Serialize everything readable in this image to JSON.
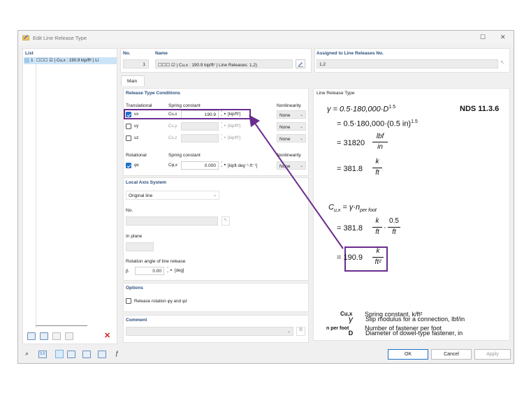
{
  "window": {
    "title": "Edit Line Release Type",
    "minimize_glyph": "☐",
    "close_glyph": "✕"
  },
  "list": {
    "header": "List",
    "item_number": "1",
    "item_text": "☐☐☐ ☑ | Cu,x : 190.9 kip/ft² | Li"
  },
  "header": {
    "no_label": "No.",
    "no_value": "1",
    "name_label": "Name",
    "name_value": "☐☐☐ ☑ | Cu,x : 190.9 kip/ft² | Line Releases: 1,2)",
    "assigned_label": "Assigned to Line Releases No.",
    "assigned_value": "1,2"
  },
  "tabs": [
    {
      "label": "Main"
    }
  ],
  "conditions": {
    "section_title": "Release Type Conditions",
    "translational_label": "Translational",
    "spring_label": "Spring constant",
    "nonlinearity_label": "Nonlinearity",
    "rows": [
      {
        "dof": "ux",
        "const": "Cu,x",
        "value": "190.9",
        "unit": "[kip/ft²]",
        "nonlin": "None"
      },
      {
        "dof": "uy",
        "const": "Cu,y",
        "value": "",
        "unit": "[kip/ft²]",
        "nonlin": "None"
      },
      {
        "dof": "uz",
        "const": "Cu,z",
        "value": "",
        "unit": "[kip/ft²]",
        "nonlin": "None"
      }
    ],
    "rotational_label": "Rotational",
    "rot_spring_label": "Spring constant",
    "rot_nonlinearity_label": "Nonlinearity",
    "rot_row": {
      "dof": "φx",
      "const": "Cφ,x",
      "value": "0.000",
      "unit": "[kipft·deg⁻¹·ft⁻¹]",
      "nonlin": "None"
    }
  },
  "local_axis": {
    "section_title": "Local Axis System",
    "dropdown_value": "Original line",
    "no_label": "No.",
    "in_plane_label": "In plane",
    "rotation_label": "Rotation angle of line release",
    "beta_symbol": "β",
    "beta_value": "0.00",
    "beta_unit": "[deg]"
  },
  "options": {
    "section_title": "Options",
    "release_rotation_label": "Release rotation φy and φz"
  },
  "comment": {
    "section_title": "Comment"
  },
  "diagram": {
    "section_title": "Line Release Type",
    "reference": "NDS 11.3.6",
    "eq1": "γ = 0.5·180,000·D",
    "eq1_exp": "1.5",
    "eq2": "= 0.5·180,000·(0.5 in)",
    "eq2_exp": "1.5",
    "eq3": "= 31820",
    "eq3_num": "lbf",
    "eq3_den": "in",
    "eq4": "= 381.8",
    "eq4_num": "k",
    "eq4_den": "ft",
    "eq5_lhs": "C",
    "eq5_sub": "u,x",
    "eq5_rhs": "= γ·n",
    "eq5_rhs_sub": "per foot",
    "eq6": "= 381.8",
    "eq6_num1": "k",
    "eq6_den1": "ft",
    "eq6_num2": "0.5",
    "eq6_den2": "ft",
    "eq7": "= 190.9",
    "eq7_num": "k",
    "eq7_den": "ft²",
    "legend": [
      {
        "symbol": "γ",
        "text": "Slip modulus for a connection, lbf/in"
      },
      {
        "symbol": "D",
        "text": "Diameter of dowel-type fastener, in"
      },
      {
        "symbol": "Cu,x",
        "text": "Spring constant, k/ft²"
      },
      {
        "symbol": "n per foot",
        "text": "Number of fastener per foot"
      }
    ]
  },
  "buttons": {
    "ok": "OK",
    "cancel": "Cancel",
    "apply": "Apply"
  },
  "colors": {
    "accent": "#1f6fc8",
    "highlight_box": "#6a2c8f",
    "section_title": "#2b4f7e",
    "delete_red": "#d22020"
  }
}
